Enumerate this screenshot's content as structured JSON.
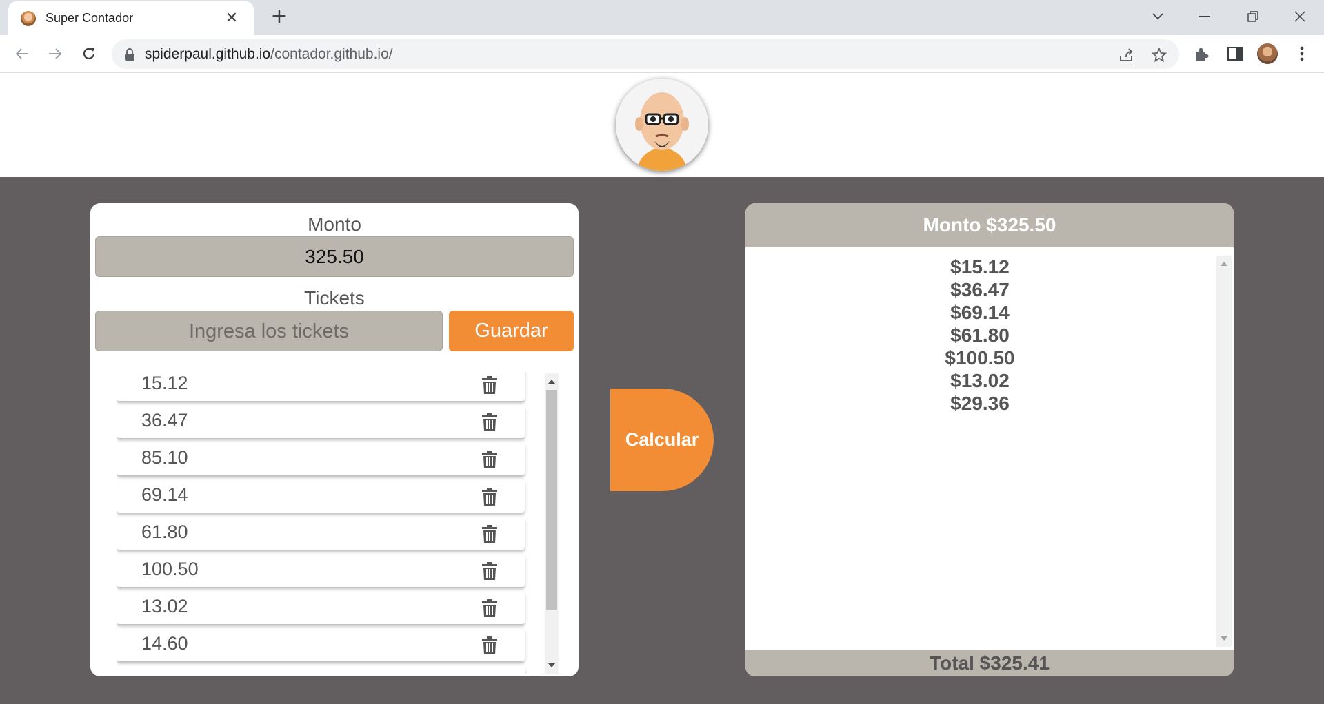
{
  "browser": {
    "tab_title": "Super Contador",
    "url_host": "spiderpaul.github.io",
    "url_path": "/contador.github.io/"
  },
  "icons": [
    "tab-favicon",
    "close-icon",
    "new-tab-icon",
    "chevron-down-icon",
    "minimize-icon",
    "restore-icon",
    "window-close-icon",
    "back-icon",
    "forward-icon",
    "reload-icon",
    "lock-icon",
    "share-icon",
    "star-icon",
    "extensions-icon",
    "side-panel-icon",
    "profile-avatar",
    "menu-icon",
    "trash-icon"
  ],
  "form": {
    "monto_label": "Monto",
    "monto_value": "325.50",
    "tickets_label": "Tickets",
    "tickets_placeholder": "Ingresa los tickets",
    "guardar_label": "Guardar"
  },
  "tickets": [
    "15.12",
    "36.47",
    "85.10",
    "69.14",
    "61.80",
    "100.50",
    "13.02",
    "14.60"
  ],
  "calcular_label": "Calcular",
  "result": {
    "header": "Monto $325.50",
    "items": [
      "$15.12",
      "$36.47",
      "$69.14",
      "$61.80",
      "$100.50",
      "$13.02",
      "$29.36"
    ],
    "total": "Total $325.41"
  },
  "colors": {
    "accent": "#f28c35",
    "panel_gray": "#bab6ad",
    "background": "#625e5f",
    "text": "#555555"
  }
}
